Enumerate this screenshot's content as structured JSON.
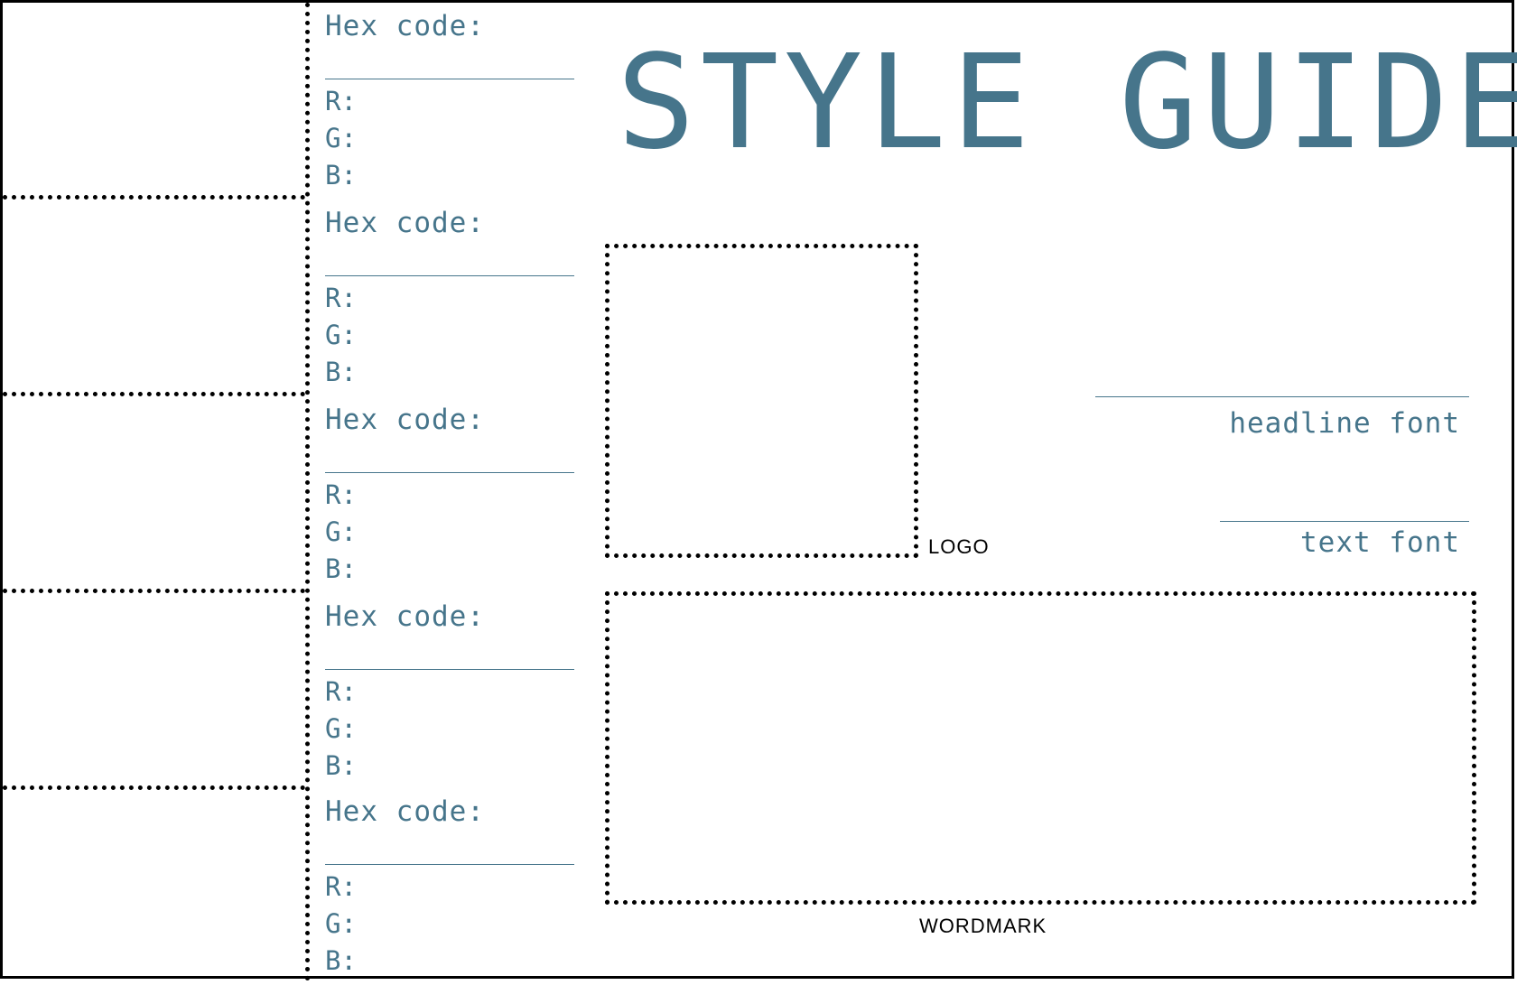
{
  "title": "STYLE GUIDE",
  "colors": [
    {
      "hex_label": "Hex code:",
      "r_label": "R:",
      "g_label": "G:",
      "b_label": "B:"
    },
    {
      "hex_label": "Hex code:",
      "r_label": "R:",
      "g_label": "G:",
      "b_label": "B:"
    },
    {
      "hex_label": "Hex code:",
      "r_label": "R:",
      "g_label": "G:",
      "b_label": "B:"
    },
    {
      "hex_label": "Hex code:",
      "r_label": "R:",
      "g_label": "G:",
      "b_label": "B:"
    },
    {
      "hex_label": "Hex code:",
      "r_label": "R:",
      "g_label": "G:",
      "b_label": "B:"
    }
  ],
  "logo": {
    "label": "LOGO"
  },
  "wordmark": {
    "label": "WORDMARK"
  },
  "fonts": {
    "headline_label": "headline font",
    "text_label": "text font"
  },
  "theme": {
    "accent": "#46758b",
    "border": "#000000",
    "background": "#ffffff"
  }
}
